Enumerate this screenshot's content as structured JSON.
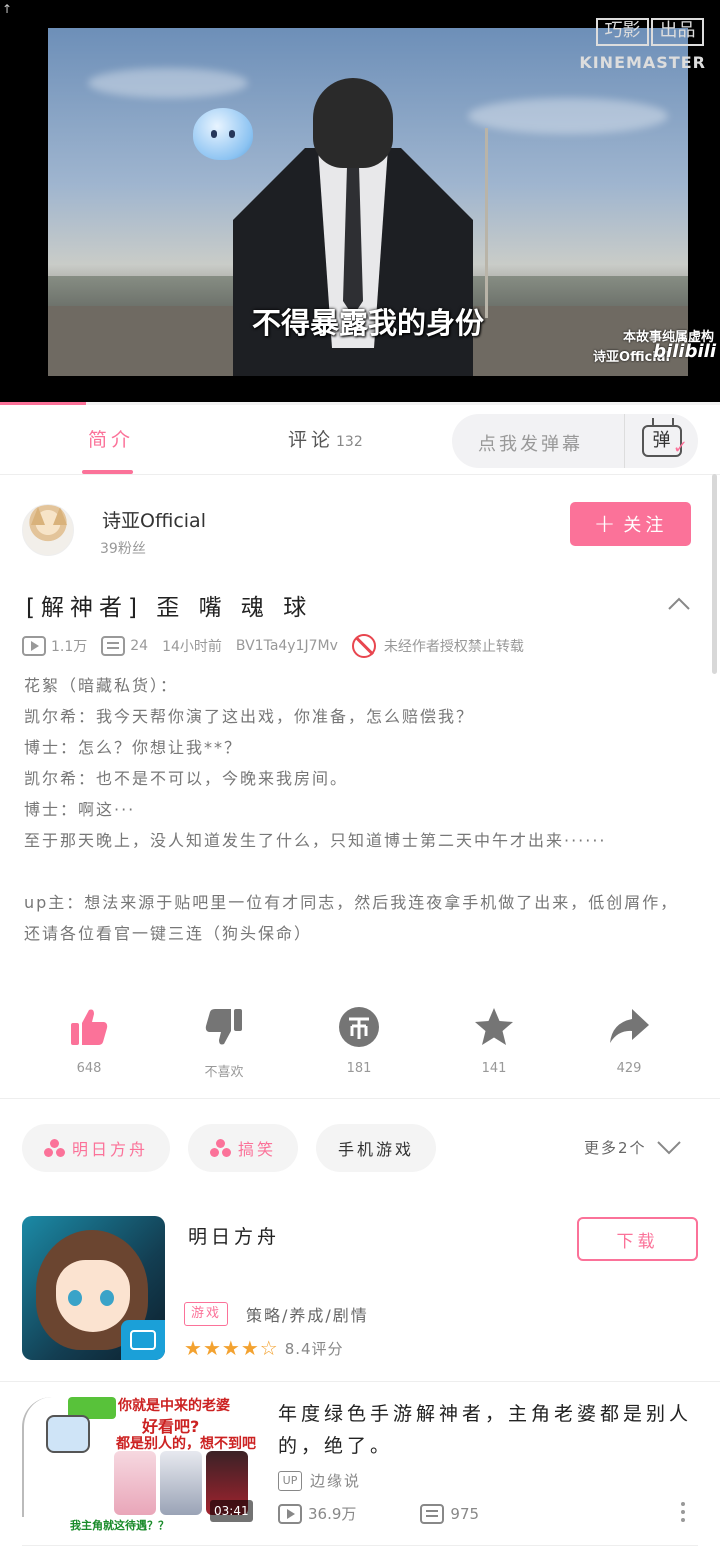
{
  "player": {
    "subtitle": "不得暴露我的身份",
    "disclaimer": "本故事纯属虚构",
    "uploader_mark": "诗亚Official",
    "platform_mark": "bilibili",
    "watermark_top": [
      "巧影",
      "出品"
    ],
    "watermark_bottom": "KINEMASTER",
    "progress": 0.12
  },
  "tabs": {
    "intro": "简介",
    "comments": "评论",
    "comments_count": "132",
    "danmu_placeholder": "点我发弹幕",
    "danmu_button": "弹"
  },
  "uploader": {
    "name": "诗亚Official",
    "fans": "39粉丝",
    "follow_label": "关注"
  },
  "video": {
    "title": "[解神者] 歪 嘴 魂 球",
    "views": "1.1万",
    "danmaku": "24",
    "time": "14小时前",
    "bvid": "BV1Ta4y1J7Mv",
    "copyright": "未经作者授权禁止转载",
    "description": "花絮（暗藏私货）：\n凯尔希：我今天帮你演了这出戏，你准备，怎么赔偿我？\n博士：怎么？你想让我**？\n凯尔希：也不是不可以，今晚来我房间。\n博士：啊这···\n至于那天晚上，没人知道发生了什么，只知道博士第二天中午才出来······\n\nup主：想法来源于贴吧里一位有才同志，然后我连夜拿手机做了出来，低创屑作，还请各位看官一键三连（狗头保命）"
  },
  "actions": {
    "like": "648",
    "dislike": "不喜欢",
    "coin": "181",
    "favorite": "141",
    "share": "429"
  },
  "tags": {
    "items": [
      "明日方舟",
      "搞笑",
      "手机游戏"
    ],
    "more": "更多2个"
  },
  "game": {
    "name": "明日方舟",
    "download": "下载",
    "tag": "游戏",
    "genre": "策略/养成/剧情",
    "rating": 4,
    "score": "8.4评分"
  },
  "related": {
    "title": "年度绿色手游解神者，主角老婆都是别人的，绝了。",
    "up_badge": "UP",
    "uploader": "边缘说",
    "views": "36.9万",
    "danmaku": "975",
    "duration": "03:41",
    "thumb_text": [
      "你就是中来的老婆",
      "好看吧?",
      "都是别人的，想不到吧",
      "我主角就这待遇？？"
    ]
  },
  "colors": {
    "accent": "#fb7299",
    "forbid": "#e8464f",
    "star": "#f3a230"
  }
}
